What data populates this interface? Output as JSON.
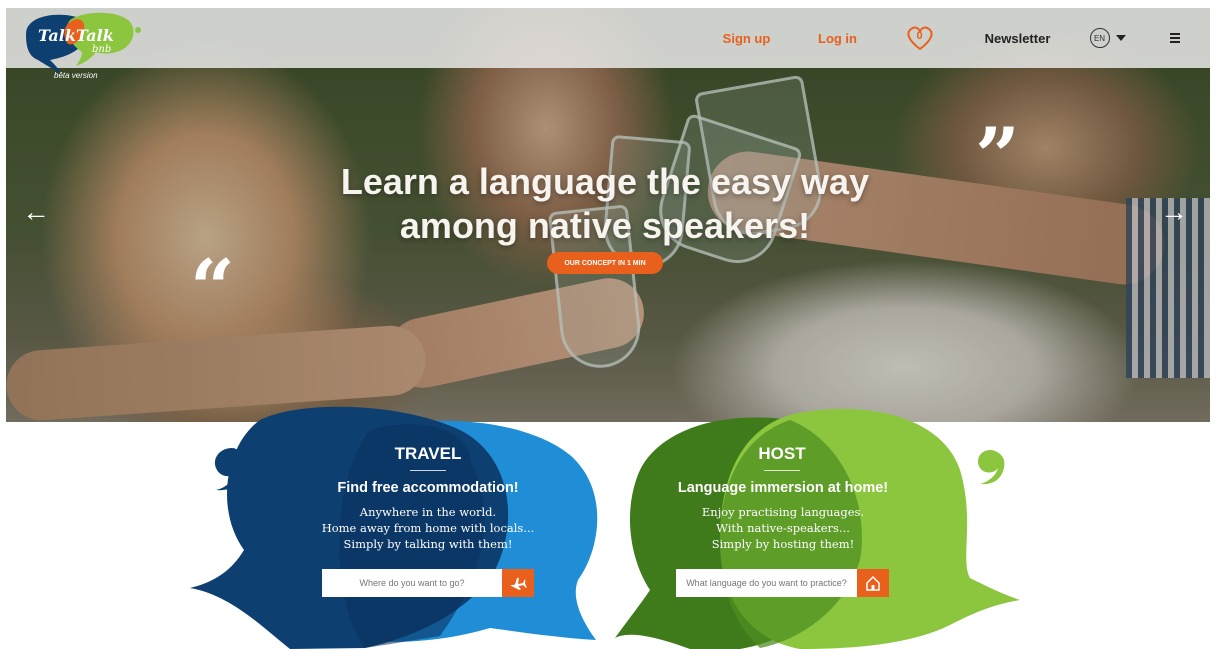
{
  "header": {
    "logo_title": "TalkTalk",
    "logo_sub": "bnb",
    "logo_version": "bêta version",
    "signup": "Sign up",
    "login": "Log in",
    "favorites_count": "0",
    "newsletter": "Newsletter",
    "language": "EN"
  },
  "hero": {
    "headline_line1": "Learn a language the easy way",
    "headline_line2": "among native speakers!",
    "cta": "OUR CONCEPT IN 1 MIN"
  },
  "travel": {
    "title": "TRAVEL",
    "subtitle": "Find free accommodation!",
    "line1": "Anywhere in the world.",
    "line2": "Home away from home with locals...",
    "line3": "Simply by talking with them!",
    "placeholder": "Where do you want to go?"
  },
  "host": {
    "title": "HOST",
    "subtitle": "Language immersion at home!",
    "line1": "Enjoy practising languages.",
    "line2": "With native-speakers...",
    "line3": "Simply by hosting them!",
    "placeholder": "What language do you want to practice?"
  },
  "colors": {
    "accent": "#e8601c",
    "travel_dark": "#0d3f70",
    "travel_light": "#1f8ed6",
    "host_dark": "#6aa82a",
    "host_light": "#8cc63f"
  },
  "icons": [
    "heart-icon",
    "globe-icon",
    "menu-icon",
    "arrow-left-icon",
    "arrow-right-icon",
    "plane-icon",
    "house-icon"
  ]
}
